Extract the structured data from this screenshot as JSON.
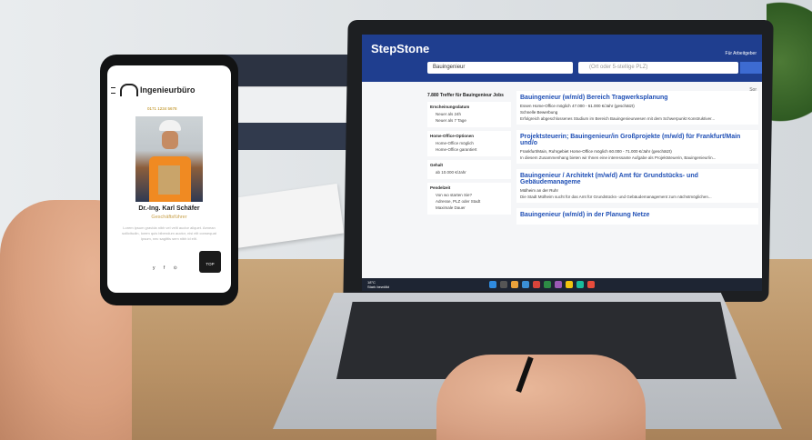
{
  "laptop": {
    "logo": "StepStone",
    "employer_link": "Für Arbeitgeber",
    "search_value": "Bauingenieur",
    "location_placeholder": "(Ort oder 5-stellige PLZ)",
    "results_count": "7.880 Treffer für Bauingenieur Jobs",
    "filters": [
      {
        "title": "Erscheinungsdatum",
        "items": [
          "Neuer als 24h",
          "Neuer als 7 Tage"
        ]
      },
      {
        "title": "Home-Office-Optionen",
        "items": [
          "Home-Office möglich",
          "Home-Office garantiert"
        ]
      },
      {
        "title": "Gehalt",
        "items": [
          "ab 10.000 €/Jahr"
        ]
      },
      {
        "title": "Pendelzeit",
        "items": [
          "Von wo starten Sie?",
          "Adresse, PLZ oder Stadt",
          "Maximale Dauer"
        ]
      }
    ],
    "jobs": [
      {
        "title": "Bauingenieur (w/m/d) Bereich Tragwerksplanung",
        "meta": "Essen   Home-Office möglich   47.000 - 61.000 €/Jahr (geschätzt)",
        "badge": "Schnelle Bewerbung",
        "desc": "Erfolgreich abgeschlossenes Studium im Bereich Bauingenieurwesen mit dem Schwerpunkt Konstruktiver..."
      },
      {
        "title": "Projektsteuerin; Bauingenieur/in Großprojekte (m/w/d) für Frankfurt/Main und/o",
        "meta": "Frankfurt/Main, Ruhrgebiet   Home-Office möglich   60.000 - 71.000 €/Jahr (geschätzt)",
        "badge": "",
        "desc": "In diesem Zusammenhang bieten wir Ihnen eine interessante Aufgabe als Projektsteuerin, Bauingenieur/in..."
      },
      {
        "title": "Bauingenieur / Architekt (m/w/d) Amt für Grundstücks- und Gebäudemanageme",
        "meta": "Mülheim an der Ruhr",
        "badge": "",
        "desc": "Die Stadt Mülheim sucht für das Amt für Grundstücks- und Gebäudemanagement zum nächstmöglichen..."
      },
      {
        "title": "Bauingenieur (w/m/d) in der Planung Netze",
        "meta": "",
        "badge": "",
        "desc": ""
      }
    ],
    "weather": [
      "18°C",
      "Stark bewölkt"
    ]
  },
  "phone": {
    "brand": "Ingenieurbüro",
    "phone_number": "0171 1234 5678",
    "person_name": "Dr.-Ing. Karl Schäfer",
    "person_role": "Geschäftsführer",
    "bio": "Lorem ipsum gravida nibh vel velit auctor aliquet. Aenean sollicitudin, lorem quis bibendum auctor, nisi elit consequat ipsum, nec sagittis sem nibh id elit.",
    "social": "y f ⊙",
    "top_button": "TOP"
  }
}
